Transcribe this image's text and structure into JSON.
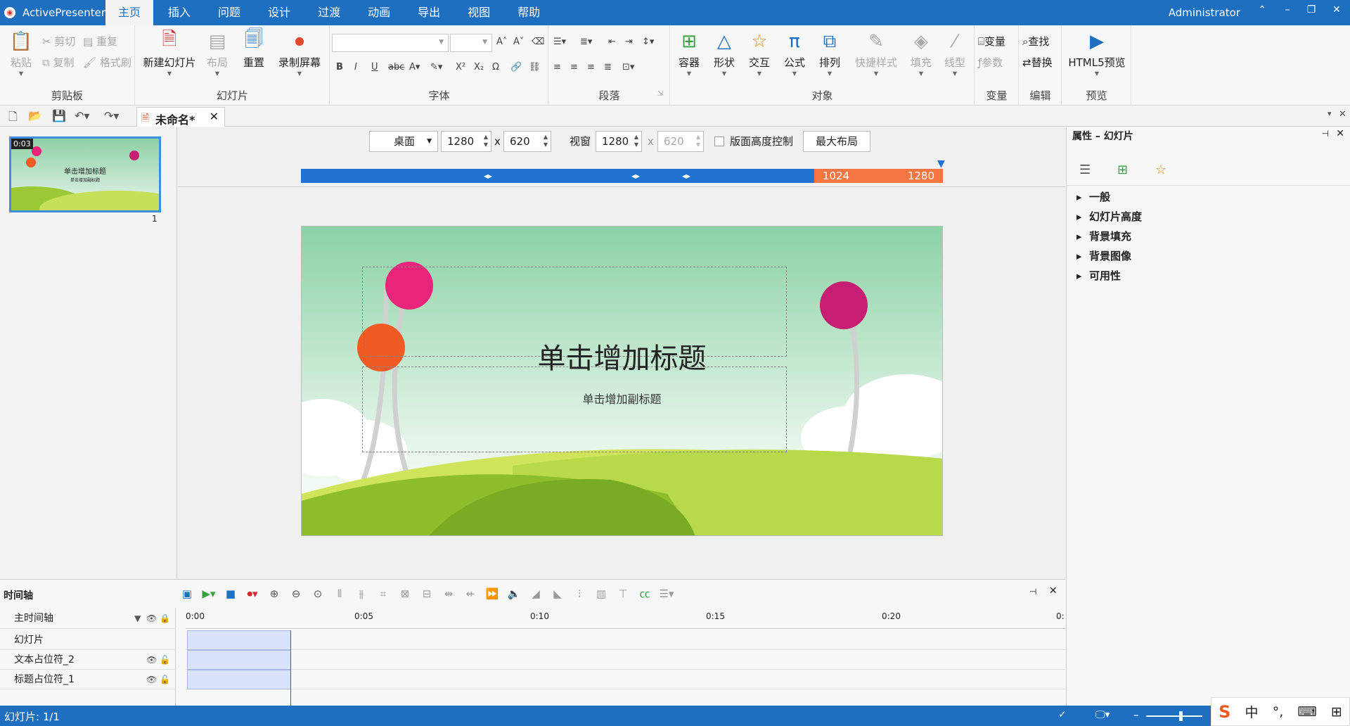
{
  "titlebar": {
    "app_name": "ActivePresenter",
    "tabs": [
      "主页",
      "插入",
      "问题",
      "设计",
      "过渡",
      "动画",
      "导出",
      "视图",
      "帮助"
    ],
    "user": "Administrator"
  },
  "ribbon": {
    "clipboard": {
      "label": "剪贴板",
      "paste": "粘贴",
      "cut": "剪切",
      "copy": "复制",
      "repeat": "重复",
      "format_painter": "格式刷"
    },
    "slides": {
      "label": "幻灯片",
      "new_slide": "新建幻灯片",
      "layout": "布局",
      "reset": "重置",
      "record_screen": "录制屏幕"
    },
    "font": {
      "label": "字体"
    },
    "paragraph": {
      "label": "段落"
    },
    "objects": {
      "label": "对象",
      "container": "容器",
      "shape": "形状",
      "interaction": "交互",
      "equation": "公式",
      "arrange": "排列",
      "quick_style": "快捷样式",
      "fill": "填充",
      "line": "线型"
    },
    "variables": {
      "label": "变量",
      "variable": "变量",
      "param": "参数"
    },
    "edit": {
      "label": "编辑",
      "find": "查找",
      "replace": "替换"
    },
    "preview": {
      "label": "预览",
      "html5": "HTML5预览"
    }
  },
  "doc_tab": {
    "title": "未命名*"
  },
  "slide_panel": {
    "thumb_time": "0:03",
    "thumb_number": "1",
    "thumb_title": "单击增加标题",
    "thumb_sub": "单击增加副标题"
  },
  "responsive": {
    "device": "桌面",
    "width": "1280",
    "x_sign": "x",
    "height": "620",
    "viewport_label": "视窗",
    "viewport_width": "1280",
    "viewport_height": "620",
    "height_control": "版面高度控制",
    "max_layout": "最大布局",
    "bp_low": "1024",
    "bp_high": "1280"
  },
  "slide": {
    "title": "单击增加标题",
    "subtitle": "单击增加副标题"
  },
  "properties": {
    "title": "属性 – 幻灯片",
    "sections": [
      "一般",
      "幻灯片高度",
      "背景填充",
      "背景图像",
      "可用性"
    ]
  },
  "timeline": {
    "title": "时间轴",
    "main": "主时间轴",
    "rows": [
      "幻灯片",
      "文本占位符_2",
      "标题占位符_1"
    ],
    "ticks": [
      "0:00",
      "0:05",
      "0:10",
      "0:15",
      "0:20",
      "0:"
    ]
  },
  "status": {
    "text": "幻灯片: 1/1"
  },
  "ime": {
    "lang": "中"
  },
  "colors": {
    "accent": "#1e6fc0",
    "breakpoint": "#f57643",
    "clip": "#d8e2fb"
  }
}
